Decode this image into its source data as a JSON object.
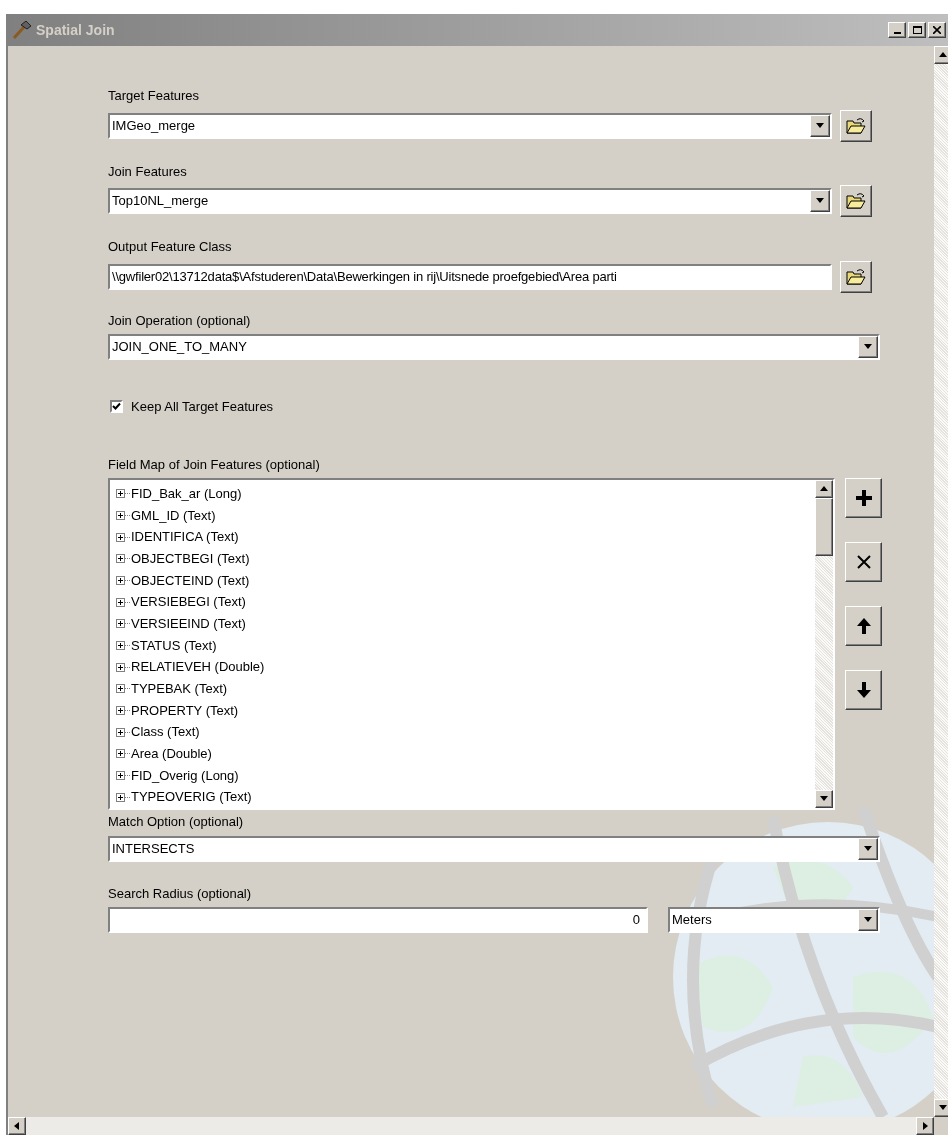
{
  "window": {
    "title": "Spatial Join"
  },
  "params": [
    {
      "kind": "combo_browse",
      "label": "Target Features",
      "value": "IMGeo_merge"
    },
    {
      "kind": "combo_browse",
      "label": "Join Features",
      "value": "Top10NL_merge"
    },
    {
      "kind": "text_browse",
      "label": "Output Feature Class",
      "value": "\\\\gwfiler02\\13712data$\\Afstuderen\\Data\\Bewerkingen in rij\\Uitsnede proefgebied\\Area parti"
    },
    {
      "kind": "combo",
      "label": "Join Operation (optional)",
      "value": "JOIN_ONE_TO_MANY"
    },
    {
      "kind": "checkbox",
      "label": "Keep All Target Features",
      "checked": true
    },
    {
      "kind": "field_map",
      "label": "Field Map of Join Features (optional)",
      "items": [
        {
          "label": "FID_Bak_ar (Long)",
          "expanded": false
        },
        {
          "label": "GML_ID (Text)",
          "expanded": false
        },
        {
          "label": "IDENTIFICA (Text)",
          "expanded": false
        },
        {
          "label": "OBJECTBEGI (Text)",
          "expanded": false
        },
        {
          "label": "OBJECTEIND (Text)",
          "expanded": false
        },
        {
          "label": "VERSIEBEGI (Text)",
          "expanded": false
        },
        {
          "label": "VERSIEEIND (Text)",
          "expanded": false
        },
        {
          "label": "STATUS (Text)",
          "expanded": false
        },
        {
          "label": "RELATIEVEH (Double)",
          "expanded": false
        },
        {
          "label": "TYPEBAK (Text)",
          "expanded": false
        },
        {
          "label": "PROPERTY (Text)",
          "expanded": false
        },
        {
          "label": "Class (Text)",
          "expanded": false
        },
        {
          "label": "Area (Double)",
          "expanded": false
        },
        {
          "label": "FID_Overig (Long)",
          "expanded": false
        },
        {
          "label": "TYPEOVERIG (Text)",
          "expanded": false
        }
      ]
    },
    {
      "kind": "combo",
      "label": "Match Option (optional)",
      "value": "INTERSECTS"
    },
    {
      "kind": "radius",
      "label": "Search Radius (optional)",
      "value": "0",
      "unit": "Meters"
    }
  ]
}
